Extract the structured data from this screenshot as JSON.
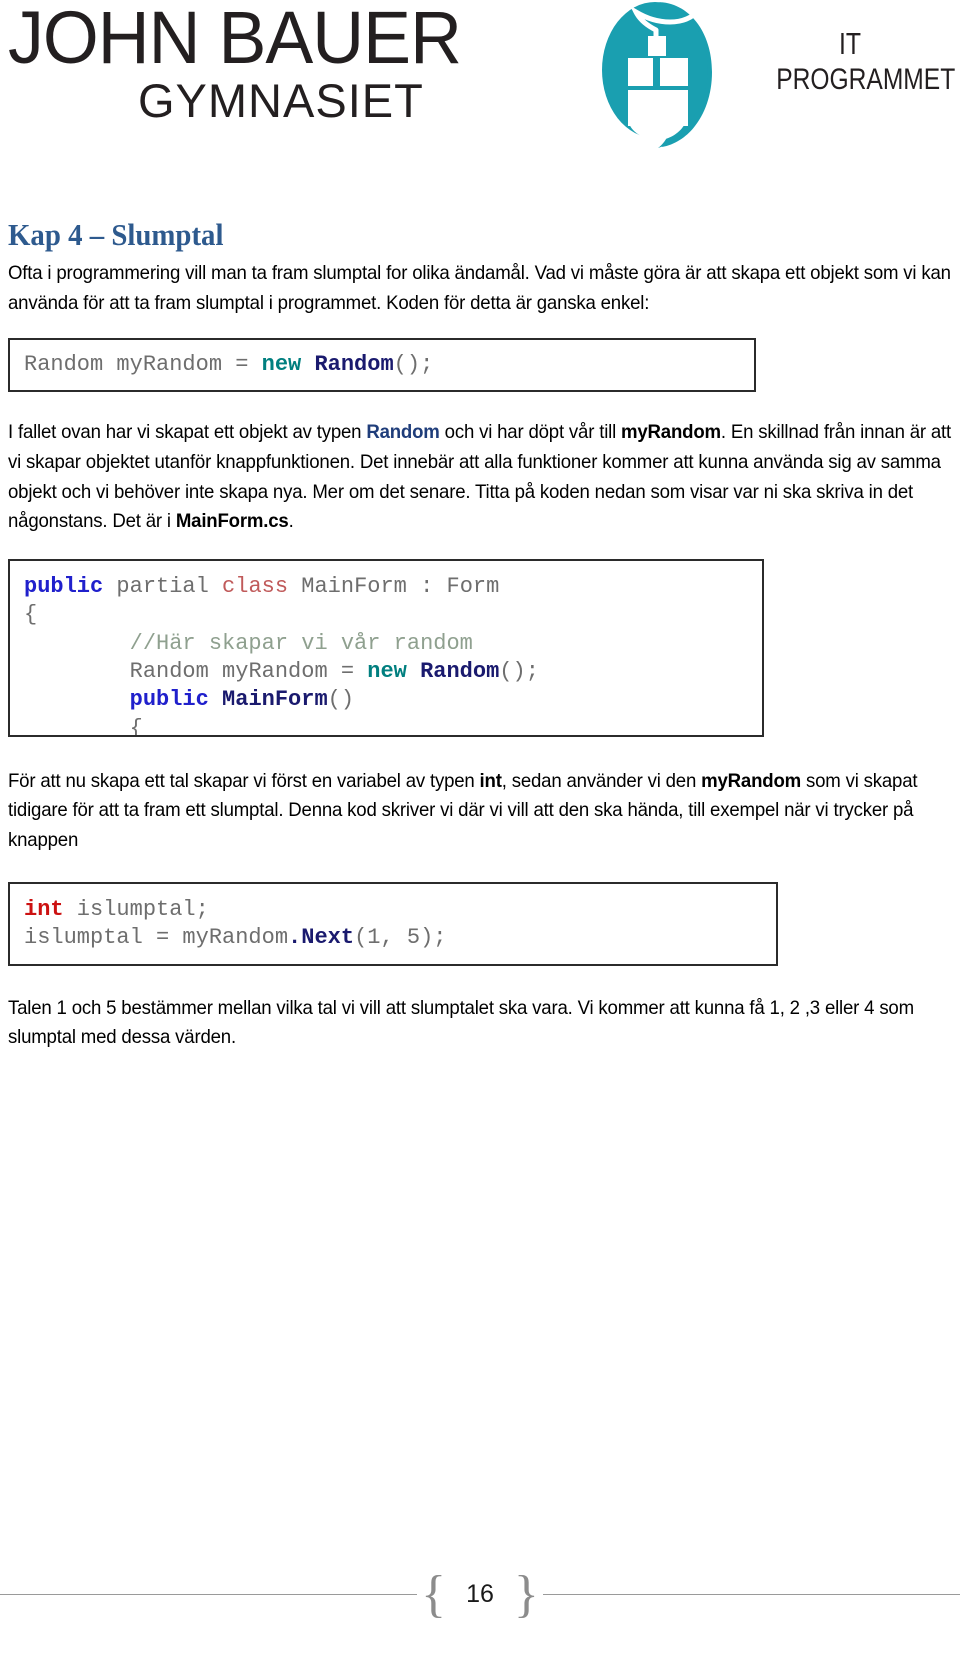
{
  "header": {
    "logo": {
      "line1": "JOHN BAUER",
      "line2": "GYMNASIET",
      "program_line1": "IT",
      "program_line2": "PROGRAMMET",
      "mark_icon": "computer-mouse-icon",
      "mark_color": "#1a9fb0",
      "text_color": "#231f20"
    }
  },
  "document": {
    "chapter_title": "Kap 4 – Slumptal",
    "chapter_title_color": "#2e5a8e",
    "para1": {
      "part1": "Ofta i programmering vill man ta fram slumptal for olika ändamål. Vad vi måste göra är att skapa ett objekt som vi kan använda för att ta fram slumptal i programmet. Koden för detta är ganska enkel:"
    },
    "code1": {
      "seg1": "Random myRandom = ",
      "seg2": "new",
      "seg3": " ",
      "seg4": "Random",
      "seg5": "();"
    },
    "para2": {
      "p1": "I fallet ovan har vi skapat ett objekt av typen ",
      "kw1": "Random",
      "p2": " och vi har döpt vår till ",
      "kw2": "myRandom",
      "p3": ". En skillnad från innan är att vi skapar objektet utanför knappfunktionen. Det innebär att alla funktioner kommer att kunna använda sig av samma objekt och vi behöver inte skapa nya. Mer om det senare. Titta på koden nedan som visar var ni ska skriva in det någonstans. Det är i ",
      "kw3": "MainForm.cs",
      "p4": "."
    },
    "code2": {
      "l1_public": "public",
      "l1_partial": " partial ",
      "l1_class": "class",
      "l1_rest": " MainForm : Form",
      "l2_brace": "{",
      "l3_comment": "        //Här skapar vi vår random",
      "l4_indent": "        ",
      "l4_seg1": "Random myRandom = ",
      "l4_new": "new",
      "l4_space": " ",
      "l4_type": "Random",
      "l4_tail": "();",
      "l5_indent": "        ",
      "l5_public": "public",
      "l5_space": " ",
      "l5_name": "MainForm",
      "l5_parens": "()",
      "l6_brace": "        {"
    },
    "para3": {
      "p1": "För att nu skapa ett tal skapar vi först en variabel av typen ",
      "kw1": "int",
      "p2": ", sedan använder vi den ",
      "kw2": "myRandom",
      "p3": " som vi skapat tidigare för att ta fram ett slumptal. Denna kod skriver vi där vi vill att den ska hända, till exempel när vi trycker på knappen"
    },
    "code3": {
      "l1_int": "int",
      "l1_rest": " islumptal;",
      "l2_seg1": "islumptal = myRandom",
      "l2_next": ".Next",
      "l2_tail": "(1, 5);"
    },
    "para4": {
      "text": "Talen 1 och 5 bestämmer mellan vilka tal vi vill att slumptalet ska vara. Vi kommer att kunna få 1, 2 ,3 eller 4 som slumptal med dessa värden."
    }
  },
  "footer": {
    "page_number": "16",
    "brace_left": "{",
    "brace_right": "}"
  },
  "colors": {
    "accent_blue": "#2e5a8e",
    "logo_teal": "#1a9fb0",
    "code_keyword_blue": "#2020cc",
    "code_type_navy": "#1a1a6e",
    "code_new_teal": "#007f7f",
    "code_class_red": "#c05a5a",
    "code_int_red": "#cc1111",
    "code_comment_green": "#8fa08f",
    "code_plain_gray": "#6e6e6e"
  }
}
